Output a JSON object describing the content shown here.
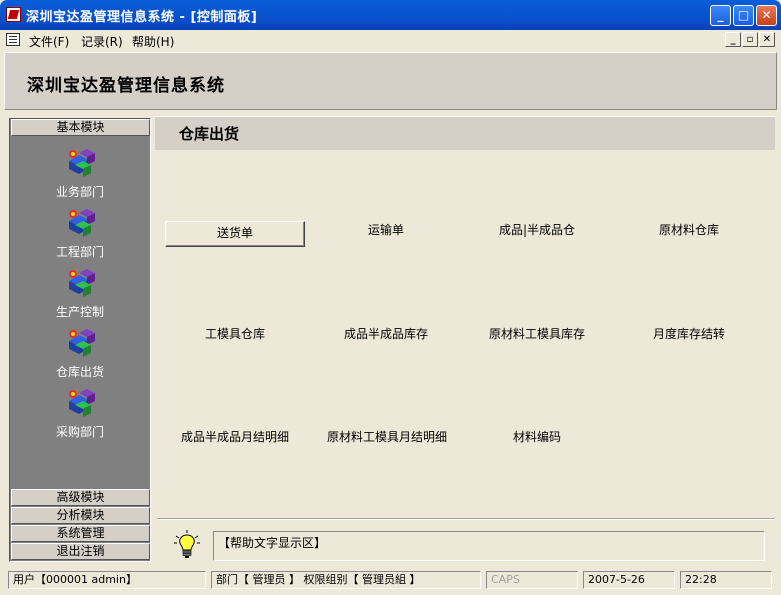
{
  "window": {
    "title": "深圳宝达盈管理信息系统 - [控制面板]"
  },
  "menu": {
    "items": [
      "文件(F)",
      "记录(R)",
      "帮助(H)"
    ]
  },
  "banner": {
    "title": "深圳宝达盈管理信息系统"
  },
  "sidebar": {
    "top_header": "基本模块",
    "modules": [
      "业务部门",
      "工程部门",
      "生产控制",
      "仓库出货",
      "采购部门"
    ],
    "bottom_headers": [
      "高级模块",
      "分析模块",
      "系统管理",
      "退出注销"
    ]
  },
  "content": {
    "title": "仓库出货",
    "items": [
      "送货单",
      "运输单",
      "成品|半成品仓",
      "原材料仓库",
      "工模具仓库",
      "成品半成品库存",
      "原材料工模具库存",
      "月度库存结转",
      "成品半成品月结明细",
      "原材料工模具月结明细",
      "材料编码"
    ],
    "selected_index": 0
  },
  "help": {
    "text": "【帮助文字显示区】"
  },
  "status": {
    "user": "用户【000001 admin】",
    "dept": "部门【 管理员 】 权限组别【 管理员組 】",
    "caps": "CAPS",
    "date": "2007-5-26",
    "time": "22:28"
  },
  "colors": {
    "titlebar": "#0a5fd8",
    "sidebar_bg": "#808080",
    "panel_bg": "#d4d0c8",
    "window_bg": "#ece9d8"
  }
}
